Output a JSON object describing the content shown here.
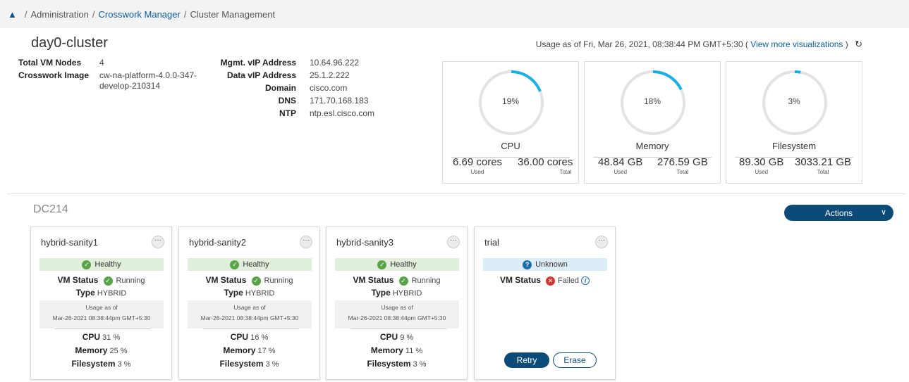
{
  "breadcrumb": {
    "items": [
      "Administration",
      "Crosswork Manager",
      "Cluster Management"
    ]
  },
  "cluster": {
    "name": "day0-cluster",
    "total_vm_nodes_label": "Total VM Nodes",
    "total_vm_nodes": "4",
    "image_label": "Crosswork Image",
    "image_line1": "cw-na-platform-4.0.0-347-",
    "image_line2": "develop-210314",
    "mgmt_vip_label": "Mgmt. vIP Address",
    "mgmt_vip": "10.64.96.222",
    "data_vip_label": "Data vIP Address",
    "data_vip": "25.1.2.222",
    "domain_label": "Domain",
    "domain": "cisco.com",
    "dns_label": "DNS",
    "dns": "171.70.168.183",
    "ntp_label": "NTP",
    "ntp": "ntp.esl.cisco.com"
  },
  "usage": {
    "prefix": "Usage as of Fri, Mar 26, 2021, 08:38:44 PM GMT+5:30 (",
    "link": "View more visualizations",
    "suffix": ")"
  },
  "gauges": [
    {
      "label": "CPU",
      "pct_text": "19%",
      "fraction": 0.19,
      "used": "6.69 cores",
      "total": "36.00 cores",
      "used_label": "Used",
      "total_label": "Total"
    },
    {
      "label": "Memory",
      "pct_text": "18%",
      "fraction": 0.18,
      "used": "48.84 GB",
      "total": "276.59 GB",
      "used_label": "Used",
      "total_label": "Total"
    },
    {
      "label": "Filesystem",
      "pct_text": "3%",
      "fraction": 0.03,
      "used": "89.30 GB",
      "total": "3033.21 GB",
      "used_label": "Used",
      "total_label": "Total"
    }
  ],
  "datacenter": {
    "name": "DC214",
    "actions_label": "Actions"
  },
  "node_labels": {
    "vm_status": "VM Status",
    "type": "Type",
    "usage_as_of": "Usage as of",
    "cpu": "CPU",
    "memory": "Memory",
    "filesystem": "Filesystem",
    "more": "···"
  },
  "nodes": [
    {
      "name": "hybrid-sanity1",
      "health": "Healthy",
      "vm_status": "Running",
      "type": "HYBRID",
      "usage_time": "Mar-26-2021 08:38:44pm GMT+5:30",
      "cpu": "31 %",
      "memory": "25 %",
      "filesystem": "3 %"
    },
    {
      "name": "hybrid-sanity2",
      "health": "Healthy",
      "vm_status": "Running",
      "type": "HYBRID",
      "usage_time": "Mar-26-2021 08:38:44pm GMT+5:30",
      "cpu": "16 %",
      "memory": "17 %",
      "filesystem": "3 %"
    },
    {
      "name": "hybrid-sanity3",
      "health": "Healthy",
      "vm_status": "Running",
      "type": "HYBRID",
      "usage_time": "Mar-26-2021 08:38:44pm GMT+5:30",
      "cpu": "9 %",
      "memory": "11 %",
      "filesystem": "3 %"
    },
    {
      "name": "trial",
      "health": "Unknown",
      "vm_status": "Failed",
      "retry_label": "Retry",
      "erase_label": "Erase"
    }
  ],
  "colors": {
    "accent": "#1ab0e0",
    "track": "#e3e3e3",
    "primary_button": "#0c4a77",
    "healthy_bg": "#e0efdc",
    "unknown_bg": "#dcedf8"
  }
}
